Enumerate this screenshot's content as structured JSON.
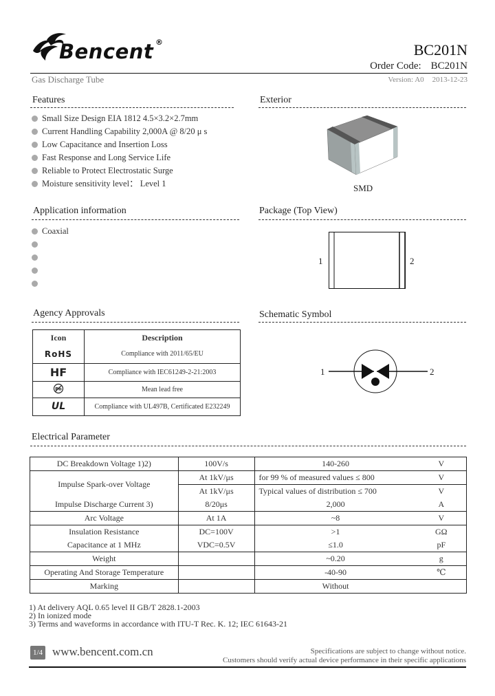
{
  "header": {
    "brand": "Bencent",
    "registered_mark": "®",
    "part_number": "BC201N",
    "order_code_label": "Order Code:",
    "order_code_value": "BC201N",
    "product_type": "Gas Discharge Tube",
    "version": "Version: A0",
    "date": "2013-12-23"
  },
  "features": {
    "title": "Features",
    "items": [
      "Small Size Design EIA 1812 4.5×3.2×2.7mm",
      "Current Handling Capability 2,000A @ 8/20 μ s",
      "Low Capacitance and Insertion Loss",
      "Fast Response and Long Service Life",
      "Reliable to Protect Electrostatic Surge",
      "Moisture sensitivity level： Level 1"
    ]
  },
  "exterior": {
    "title": "Exterior",
    "caption": "SMD"
  },
  "application": {
    "title": "Application information",
    "items": [
      "Coaxial",
      "",
      "",
      "",
      ""
    ]
  },
  "package": {
    "title": "Package (Top View)",
    "pin1": "1",
    "pin2": "2"
  },
  "agency": {
    "title": "Agency Approvals",
    "headers": [
      "Icon",
      "Description"
    ],
    "rows": [
      {
        "icon": "rohs-icon",
        "icon_text": "RoHS",
        "description": "Compliance with 2011/65/EU"
      },
      {
        "icon": "hf-icon",
        "icon_text": "HF",
        "description": "Compliance with IEC61249-2-21:2003"
      },
      {
        "icon": "pb-free-icon",
        "icon_text": "Pb",
        "description": "Mean lead free"
      },
      {
        "icon": "ul-icon",
        "icon_text": "UL",
        "description": "Compliance with UL497B, Certificated E232249"
      }
    ]
  },
  "schematic": {
    "title": "Schematic Symbol",
    "pin1": "1",
    "pin2": "2"
  },
  "electrical": {
    "title": "Electrical Parameter",
    "rows": [
      {
        "param": "DC Breakdown Voltage 1)2)",
        "condition": "100V/s",
        "value": "140-260",
        "unit": "V"
      },
      {
        "param": "Impulse Spark-over Voltage",
        "condition": "At 1kV/μs",
        "value": "for 99 % of measured values    ≤ 800",
        "unit": "V"
      },
      {
        "param": "",
        "condition": "At 1kV/μs",
        "value": "Typical values of distribution    ≤ 700",
        "unit": "V"
      },
      {
        "param": "Impulse Discharge Current 3)",
        "condition": "8/20μs",
        "value": "2,000",
        "unit": "A"
      },
      {
        "param": "Arc Voltage",
        "condition": "At 1A",
        "value": "~8",
        "unit": "V"
      },
      {
        "param": "Insulation Resistance",
        "condition": "DC=100V",
        "value": ">1",
        "unit": "GΩ"
      },
      {
        "param": "Capacitance at 1 MHz",
        "condition": "VDC=0.5V",
        "value": "≤1.0",
        "unit": "pF"
      },
      {
        "param": "Weight",
        "condition": "",
        "value": "~0.20",
        "unit": "g"
      },
      {
        "param": "Operating And Storage Temperature",
        "condition": "",
        "value": "-40-90",
        "unit": "℃"
      },
      {
        "param": "Marking",
        "condition": "",
        "value": "Without",
        "unit": ""
      }
    ]
  },
  "notes": [
    "1) At delivery AQL 0.65 level II GB/T 2828.1-2003",
    "2) In ionized mode",
    "3) Terms and waveforms in accordance with ITU-T Rec. K. 12; IEC 61643-21"
  ],
  "footer": {
    "page": "1/4",
    "website": "www.bencent.com.cn",
    "disclaimer_line1": "Specifications are subject to change without notice.",
    "disclaimer_line2": "Customers should verify actual device performance in their specific applications"
  }
}
